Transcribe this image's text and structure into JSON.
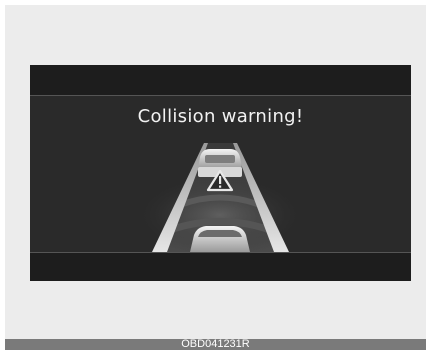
{
  "display": {
    "message": "Collision warning!",
    "warning_icon": "warning-triangle-icon",
    "lead_vehicle_icon": "car-rear-icon",
    "own_vehicle_icon": "car-hood-icon"
  },
  "figure_code": "OBD041231R",
  "colors": {
    "screen_bg": "#2a2a2a",
    "band_bg": "#1d1d1d",
    "text": "#f2f2f2",
    "caption_bar": "#7a7a7a"
  }
}
